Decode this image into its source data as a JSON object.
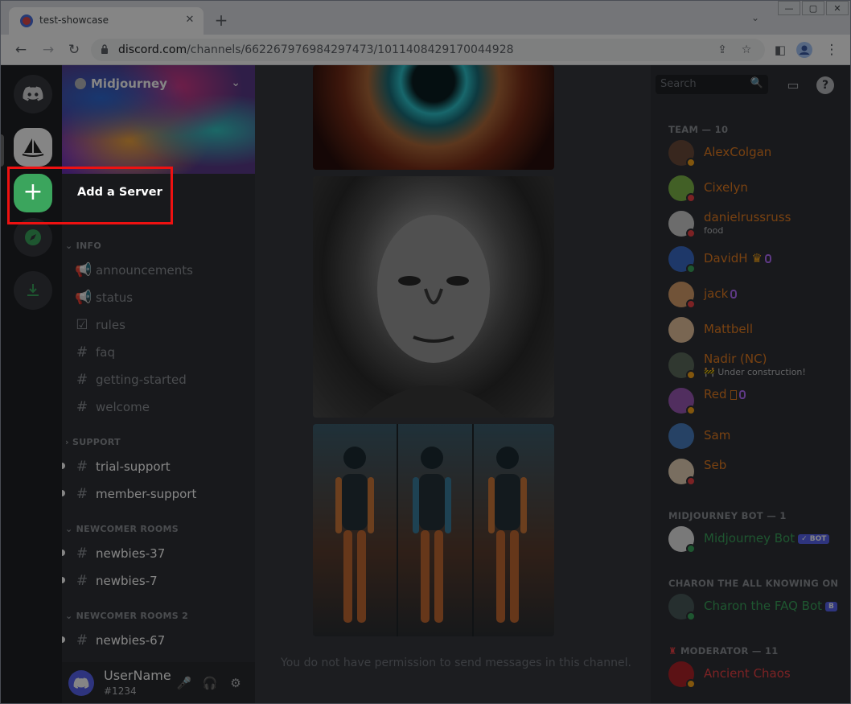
{
  "browser": {
    "tab_title": "test-showcase",
    "url_host": "discord.com",
    "url_path": "/channels/662267976984297473/1011408429170044928",
    "new_tab_label": "+",
    "tab_close_glyph": "✕"
  },
  "server": {
    "name": "Midjourney"
  },
  "guild_bar": {
    "add_server_glyph": "+",
    "tooltip": "Add a Server"
  },
  "channels": {
    "categories": [
      {
        "label": "INFO"
      },
      {
        "label": "SUPPORT"
      },
      {
        "label": "NEWCOMER ROOMS"
      },
      {
        "label": "NEWCOMER ROOMS 2"
      }
    ],
    "info": [
      {
        "label": "announcements",
        "icon": "megaphone-icon",
        "glyph": "📢"
      },
      {
        "label": "status",
        "icon": "megaphone-icon",
        "glyph": "📢"
      },
      {
        "label": "rules",
        "icon": "checkbox-icon",
        "glyph": "☑"
      },
      {
        "label": "faq",
        "icon": "hash-icon",
        "glyph": "#"
      },
      {
        "label": "getting-started",
        "icon": "hash-icon",
        "glyph": "#"
      },
      {
        "label": "welcome",
        "icon": "hash-icon",
        "glyph": "#"
      }
    ],
    "support": [
      {
        "label": "trial-support",
        "icon": "hash-icon",
        "glyph": "#"
      },
      {
        "label": "member-support",
        "icon": "thread-hash-icon",
        "glyph": "#"
      }
    ],
    "newcomer": [
      {
        "label": "newbies-37",
        "icon": "thread-hash-icon",
        "glyph": "#"
      },
      {
        "label": "newbies-7",
        "icon": "thread-hash-icon",
        "glyph": "#"
      }
    ],
    "newcomer2": [
      {
        "label": "newbies-67",
        "icon": "thread-hash-icon",
        "glyph": "#"
      }
    ]
  },
  "user": {
    "name": "UserName",
    "tag": "#1234"
  },
  "main": {
    "input_hint": "You do not have permission to send messages in this channel."
  },
  "members": {
    "search_placeholder": "Search",
    "categories": [
      {
        "label": "TEAM — 10"
      },
      {
        "label": "MIDJOURNEY BOT — 1"
      },
      {
        "label": "CHARON THE ALL KNOWING ON"
      },
      {
        "label": "MODERATOR — 11"
      }
    ],
    "team": [
      {
        "name": "AlexColgan",
        "sub": "",
        "color": "#e67e22"
      },
      {
        "name": "Cixelyn",
        "sub": "",
        "color": "#e67e22"
      },
      {
        "name": "danielrussruss",
        "sub": "food",
        "color": "#e67e22"
      },
      {
        "name": "DavidH",
        "sub": "",
        "color": "#e67e22"
      },
      {
        "name": "jack",
        "sub": "",
        "color": "#e67e22"
      },
      {
        "name": "Mattbell",
        "sub": "",
        "color": "#e67e22"
      },
      {
        "name": "Nadir (NC)",
        "sub": "🚧 Under construction!",
        "color": "#e67e22"
      },
      {
        "name": "Red",
        "sub": "",
        "color": "#e67e22"
      },
      {
        "name": "Sam",
        "sub": "",
        "color": "#e67e22"
      },
      {
        "name": "Seb",
        "sub": "",
        "color": "#e67e22"
      }
    ],
    "bot": {
      "name": "Midjourney Bot",
      "badge": "✓ BOT",
      "color": "#3ba55d"
    },
    "charon": {
      "name": "Charon the FAQ Bot",
      "badge": "B",
      "color": "#3ba55d"
    },
    "moderator": {
      "name": "Ancient Chaos",
      "color": "#ed4245"
    }
  },
  "colors": {
    "accent_green": "#3ba55d",
    "highlight_red": "#ee1111",
    "blurple": "#5865f2"
  }
}
